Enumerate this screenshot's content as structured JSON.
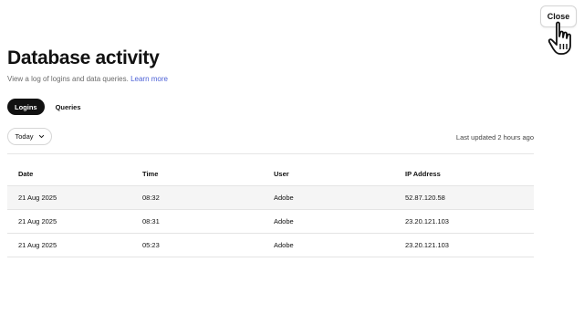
{
  "header": {
    "close_label": "Close",
    "title": "Database activity",
    "subtitle": "View a log of logins and data queries.",
    "learn_more": "Learn more"
  },
  "tabs": [
    {
      "label": "Logins",
      "active": true
    },
    {
      "label": "Queries",
      "active": false
    }
  ],
  "filter": {
    "selected": "Today"
  },
  "status": {
    "last_updated": "Last updated 2 hours ago"
  },
  "table": {
    "columns": [
      "Date",
      "Time",
      "User",
      "IP Address"
    ],
    "rows": [
      [
        "21 Aug 2025",
        "08:32",
        "Adobe",
        "52.87.120.58"
      ],
      [
        "21 Aug 2025",
        "08:31",
        "Adobe",
        "23.20.121.103"
      ],
      [
        "21 Aug 2025",
        "05:23",
        "Adobe",
        "23.20.121.103"
      ]
    ]
  },
  "colors": {
    "link": "#4a5fd6",
    "active_tab": "#111111",
    "row_highlight": "#f5f5f5"
  },
  "icons": {
    "filter": "chevron-down-icon",
    "cursor": "hand-pointer-icon"
  }
}
